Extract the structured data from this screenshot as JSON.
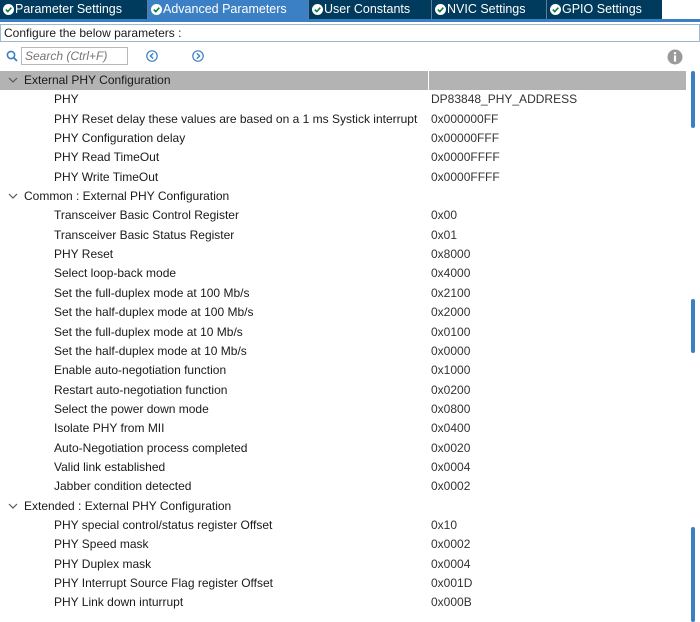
{
  "tabs": [
    {
      "label": "Parameter Settings",
      "active": false
    },
    {
      "label": "Advanced Parameters",
      "active": true
    },
    {
      "label": "User Constants",
      "active": false
    },
    {
      "label": "NVIC Settings",
      "active": false
    },
    {
      "label": "GPIO Settings",
      "active": false
    }
  ],
  "hint": "Configure the below parameters :",
  "search": {
    "placeholder": "Search (Ctrl+F)"
  },
  "icons": {
    "tab_status": "check-circle-icon",
    "search": "search-icon",
    "previous": "previous-icon",
    "next": "next-icon",
    "info": "info-icon",
    "expand": "chevron-down-icon"
  },
  "colors": {
    "tab_active": "#3b7fc4",
    "tab_inactive": "#003a5c",
    "selected_row": "#b3b3b3",
    "scroll_thumb": "#3b7fc4"
  },
  "groups": [
    {
      "label": "External PHY Configuration",
      "selected": true,
      "params": [
        {
          "name": "PHY",
          "value": "DP83848_PHY_ADDRESS"
        },
        {
          "name": "PHY Reset delay these values are based on a 1 ms Systick interrupt",
          "value": "0x000000FF"
        },
        {
          "name": "PHY Configuration delay",
          "value": "0x00000FFF"
        },
        {
          "name": "PHY Read TimeOut",
          "value": "0x0000FFFF"
        },
        {
          "name": "PHY Write TimeOut",
          "value": "0x0000FFFF"
        }
      ]
    },
    {
      "label": "Common : External PHY Configuration",
      "selected": false,
      "params": [
        {
          "name": "Transceiver Basic Control Register",
          "value": "0x00"
        },
        {
          "name": "Transceiver Basic Status Register",
          "value": "0x01"
        },
        {
          "name": "PHY Reset",
          "value": "0x8000"
        },
        {
          "name": "Select loop-back mode",
          "value": "0x4000"
        },
        {
          "name": "Set the full-duplex mode at 100 Mb/s",
          "value": "0x2100"
        },
        {
          "name": "Set the half-duplex mode at 100 Mb/s",
          "value": "0x2000"
        },
        {
          "name": "Set the full-duplex mode at 10 Mb/s",
          "value": "0x0100"
        },
        {
          "name": "Set the half-duplex mode at 10 Mb/s",
          "value": "0x0000"
        },
        {
          "name": "Enable auto-negotiation function",
          "value": "0x1000"
        },
        {
          "name": "Restart auto-negotiation function",
          "value": "0x0200"
        },
        {
          "name": "Select the power down mode",
          "value": "0x0800"
        },
        {
          "name": "Isolate PHY from MII",
          "value": "0x0400"
        },
        {
          "name": "Auto-Negotiation process completed",
          "value": "0x0020"
        },
        {
          "name": "Valid link established",
          "value": "0x0004"
        },
        {
          "name": "Jabber condition detected",
          "value": "0x0002"
        }
      ]
    },
    {
      "label": "Extended : External PHY Configuration",
      "selected": false,
      "params": [
        {
          "name": "PHY special control/status register Offset",
          "value": "0x10"
        },
        {
          "name": "PHY Speed mask",
          "value": "0x0002"
        },
        {
          "name": "PHY Duplex mask",
          "value": "0x0004"
        },
        {
          "name": "PHY Interrupt Source Flag register Offset",
          "value": "0x001D"
        },
        {
          "name": "PHY Link down inturrupt",
          "value": "0x000B"
        }
      ]
    }
  ]
}
